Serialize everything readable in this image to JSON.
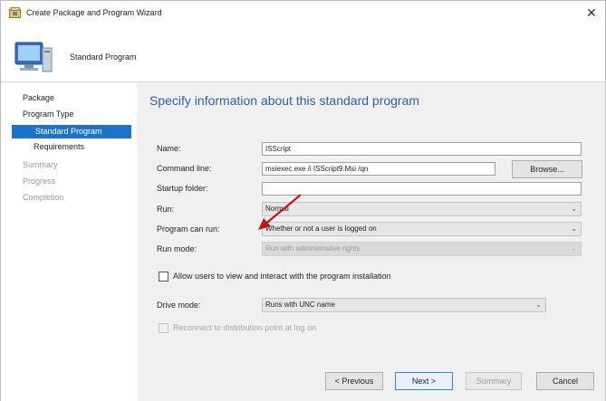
{
  "window": {
    "title": "Create Package and Program Wizard",
    "close_glyph": "✕"
  },
  "header": {
    "title": "Standard Program"
  },
  "sidebar": {
    "items": [
      {
        "label": "Package"
      },
      {
        "label": "Program Type"
      },
      {
        "label": "Standard Program"
      },
      {
        "label": "Requirements"
      },
      {
        "label": "Summary"
      },
      {
        "label": "Progress"
      },
      {
        "label": "Completion"
      }
    ]
  },
  "main": {
    "heading": "Specify information about this standard program",
    "name": {
      "label": "Name:",
      "value": "ISScript"
    },
    "command_line": {
      "label": "Command line:",
      "value": "msiexec.exe /i ISScript9.Msi /qn",
      "browse_label": "Browse..."
    },
    "startup_folder": {
      "label": "Startup folder:",
      "value": ""
    },
    "run": {
      "label": "Run:",
      "value": "Normal"
    },
    "program_can_run": {
      "label": "Program can run:",
      "value": "Whether or not a user is logged on"
    },
    "run_mode": {
      "label": "Run mode:",
      "value": "Run with administrative rights"
    },
    "allow_interact": {
      "label": "Allow users to view and interact with the program installation"
    },
    "drive_mode": {
      "label": "Drive mode:",
      "value": "Runs with UNC name"
    },
    "reconnect": {
      "label": "Reconnect to distribution point at log on"
    }
  },
  "footer": {
    "previous_label": "< Previous",
    "next_label": "Next >",
    "summary_label": "Summary",
    "cancel_label": "Cancel"
  },
  "icons": {
    "dropdown_glyph": "⌄"
  },
  "colors": {
    "accent": "#1e72c7",
    "heading": "#2f5fa8",
    "annotation_arrow": "#c0141b"
  }
}
